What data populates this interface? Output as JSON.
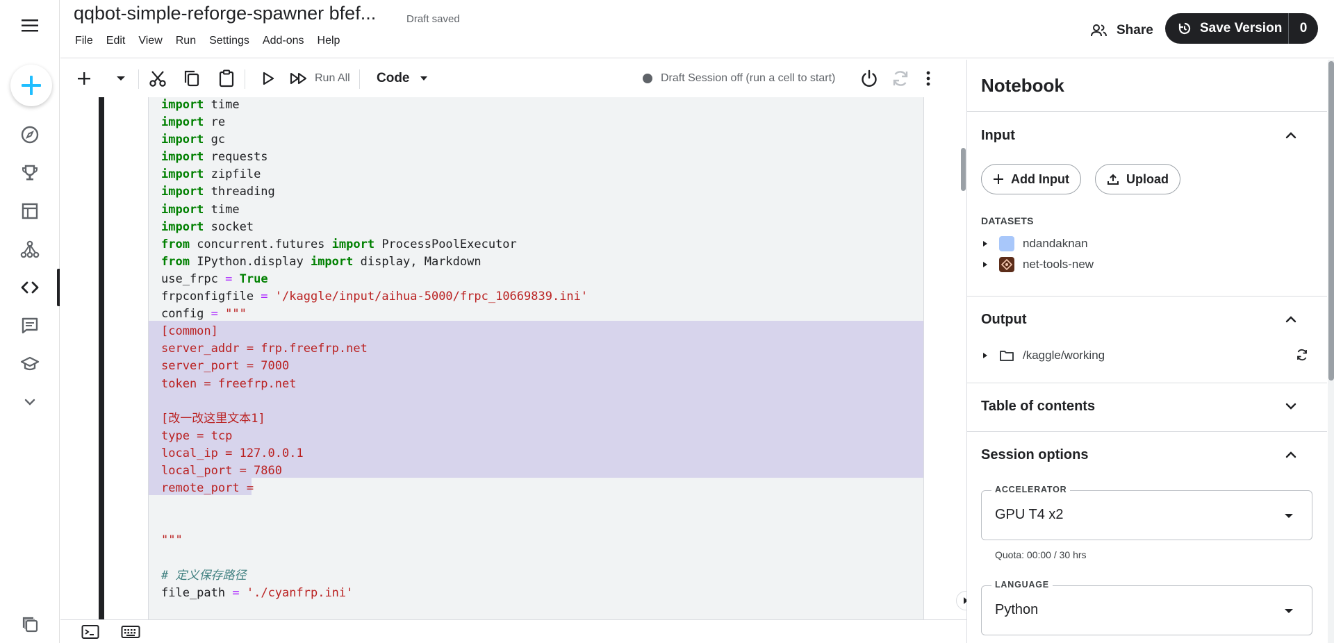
{
  "rail": {
    "items": [
      {
        "icon": "compass-icon",
        "label": "Explore"
      },
      {
        "icon": "trophy-icon",
        "label": "Competitions"
      },
      {
        "icon": "table-icon",
        "label": "Datasets"
      },
      {
        "icon": "models-icon",
        "label": "Models"
      },
      {
        "icon": "code-icon",
        "label": "Code",
        "active": true
      },
      {
        "icon": "discussion-icon",
        "label": "Discussions"
      },
      {
        "icon": "learn-icon",
        "label": "Learn"
      },
      {
        "icon": "chevron-down-icon",
        "label": "More"
      }
    ]
  },
  "header": {
    "title": "qqbot-simple-reforge-spawner bfef...",
    "draft_status": "Draft saved",
    "menu": [
      "File",
      "Edit",
      "View",
      "Run",
      "Settings",
      "Add-ons",
      "Help"
    ],
    "share_label": "Share",
    "save_version_label": "Save Version",
    "version_count": "0"
  },
  "toolbar": {
    "run_all_label": "Run All",
    "cell_type": "Code",
    "session_status": "Draft Session off (run a cell to start)"
  },
  "editor": {
    "code_lines": [
      "import time",
      "import re",
      "import gc",
      "import requests",
      "import zipfile",
      "import threading",
      "import time",
      "import socket",
      "from concurrent.futures import ProcessPoolExecutor",
      "from IPython.display import display, Markdown",
      "use_frpc = True",
      "frpconfigfile = '/kaggle/input/aihua-5000/frpc_10669839.ini'",
      "config = \"\"\"",
      "[common]",
      "server_addr = frp.freefrp.net",
      "server_port = 7000",
      "token = freefrp.net",
      "",
      "[改一改这里文本1]",
      "type = tcp",
      "local_ip = 127.0.0.1",
      "local_port = 7860",
      "remote_port = ",
      "",
      "",
      "\"\"\"",
      "",
      "# 定义保存路径",
      "file_path = './cyanfrp.ini'"
    ]
  },
  "panel": {
    "title": "Notebook",
    "input": {
      "title": "Input",
      "add_input_label": "Add Input",
      "upload_label": "Upload",
      "datasets_label": "DATASETS",
      "datasets": [
        {
          "name": "ndandaknan",
          "thumb_color": "#a8c7fa"
        },
        {
          "name": "net-tools-new",
          "thumb_color": "#5c2d1a"
        }
      ]
    },
    "output": {
      "title": "Output",
      "path": "/kaggle/working"
    },
    "toc": {
      "title": "Table of contents"
    },
    "session": {
      "title": "Session options",
      "accelerator_label": "ACCELERATOR",
      "accelerator_value": "GPU T4 x2",
      "quota": "Quota: 00:00 / 30 hrs",
      "language_label": "LANGUAGE",
      "language_value": "Python"
    }
  },
  "colors": {
    "accent": "#20beff",
    "dark": "#202124",
    "selection": "#d7d4ec",
    "keyword": "#008000",
    "string": "#ba2121",
    "operator": "#aa22ff",
    "comment": "#408080"
  }
}
